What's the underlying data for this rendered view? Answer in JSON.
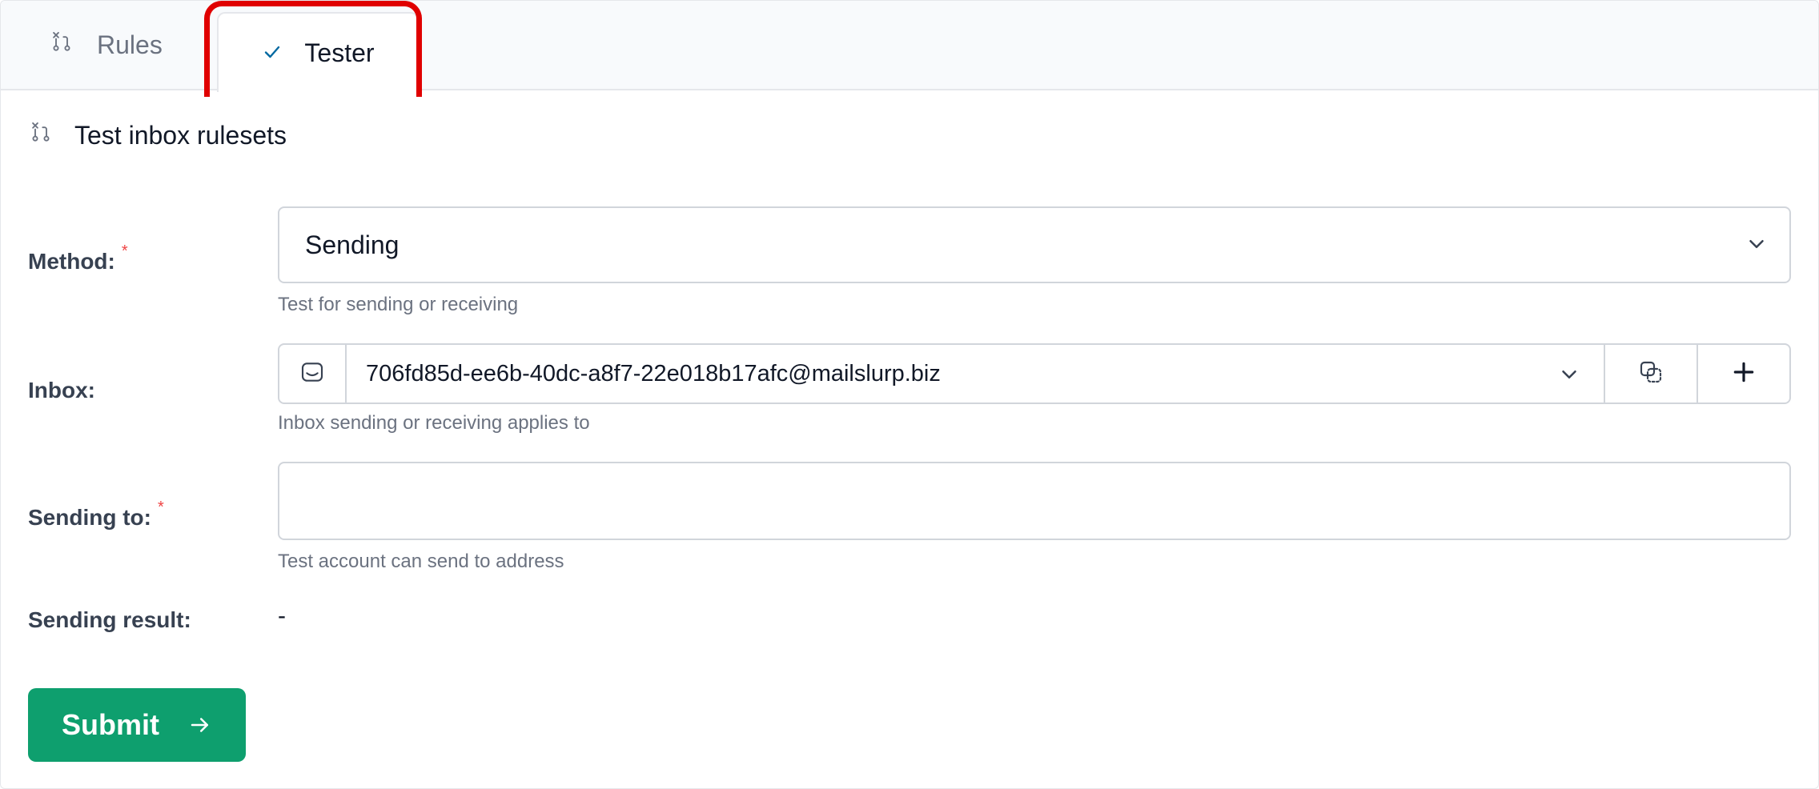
{
  "tabs": {
    "rules_label": "Rules",
    "tester_label": "Tester"
  },
  "section": {
    "title": "Test inbox rulesets"
  },
  "form": {
    "method": {
      "label": "Method:",
      "required_mark": "*",
      "value": "Sending",
      "help": "Test for sending or receiving"
    },
    "inbox": {
      "label": "Inbox:",
      "value": "706fd85d-ee6b-40dc-a8f7-22e018b17afc@mailslurp.biz",
      "help": "Inbox sending or receiving applies to"
    },
    "sending_to": {
      "label": "Sending to:",
      "required_mark": "*",
      "value": "",
      "placeholder": "",
      "help": "Test account can send to address"
    },
    "sending_result": {
      "label": "Sending result:",
      "value": "-"
    }
  },
  "submit_label": "Submit",
  "icons": {
    "rules": "git-pull-request-closed-icon",
    "tester": "check-icon",
    "inbox": "inbox-icon",
    "copy": "copy-icon",
    "add": "plus-icon",
    "dropdown": "chevron-down-icon",
    "submit": "arrow-right-icon"
  },
  "colors": {
    "accent_green": "#0e9f6e",
    "required_red": "#ef4444",
    "highlight_red": "#e00000",
    "tester_check": "#0369a1"
  }
}
